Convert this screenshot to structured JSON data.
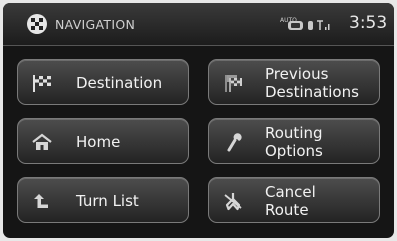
{
  "header": {
    "title": "NAVIGATION",
    "status_auto_label": "AUTO",
    "clock": "3:53"
  },
  "buttons": {
    "destination": {
      "label": "Destination",
      "icon": "checkered-flag-icon"
    },
    "previous_destinations": {
      "line1": "Previous",
      "line2": "Destinations",
      "icon": "stacked-flags-icon"
    },
    "home": {
      "label": "Home",
      "icon": "house-icon"
    },
    "routing_options": {
      "line1": "Routing",
      "line2": "Options",
      "icon": "wrench-icon"
    },
    "turn_list": {
      "label": "Turn List",
      "icon": "turn-arrow-icon"
    },
    "cancel_route": {
      "line1": "Cancel",
      "line2": "Route",
      "icon": "cancel-route-icon"
    }
  },
  "colors": {
    "screen_bg": "#151515",
    "button_border": "#7a7a7a",
    "text": "#f2f2f2"
  }
}
